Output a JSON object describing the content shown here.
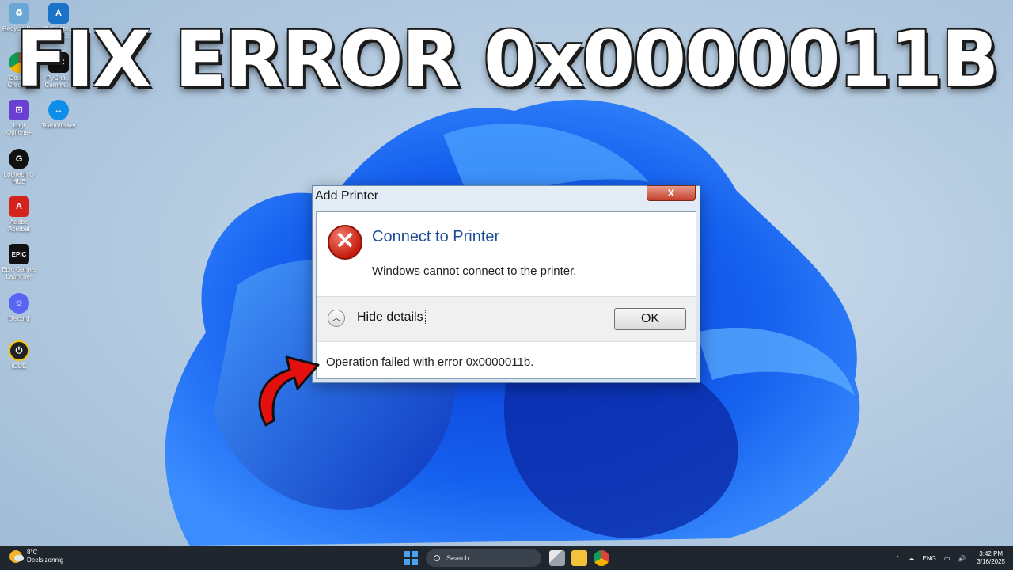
{
  "headline": "FIX ERROR 0x0000011B",
  "desktop_icons": [
    {
      "label": "Recycle Bin",
      "icon": "recycle-bin-icon",
      "color": "#6aa6d6"
    },
    {
      "label": "AVG Inte... Secur...",
      "icon": "avg-icon",
      "color": "#1a73c9"
    },
    {
      "label": "Google Chrome",
      "icon": "chrome-icon",
      "color": "#db4437"
    },
    {
      "label": "PyCha... Commu...",
      "icon": "pycharm-icon",
      "color": "#111111"
    },
    {
      "label": "Logi Options+",
      "icon": "logi-options-icon",
      "color": "#6b3fd1"
    },
    {
      "label": "TeamViewer",
      "icon": "teamviewer-icon",
      "color": "#0e8ee9"
    },
    {
      "label": "Logitech G HUB",
      "icon": "logitech-ghub-icon",
      "color": "#111111"
    },
    {
      "label": "Adobe Acrobat",
      "icon": "acrobat-icon",
      "color": "#d4231c"
    },
    {
      "label": "Epic Games Launcher",
      "icon": "epic-games-icon",
      "color": "#111111"
    },
    {
      "label": "Discord",
      "icon": "discord-icon",
      "color": "#5865f2"
    },
    {
      "label": "iCUE",
      "icon": "icue-icon",
      "color": "#222222"
    }
  ],
  "dialog": {
    "title": "Add Printer",
    "close_glyph": "x",
    "heading": "Connect to Printer",
    "message": "Windows cannot connect to the printer.",
    "hide_details": "Hide details",
    "ok_label": "OK",
    "detail": "Operation failed with error 0x0000011b."
  },
  "taskbar": {
    "weather_temp": "8°C",
    "weather_desc": "Deels zonnig",
    "search_placeholder": "Search",
    "language": "ENG",
    "time": "3:42 PM",
    "date": "3/16/2025"
  },
  "colors": {
    "accent_blue": "#1d4c96",
    "error_red": "#c51d0f",
    "arrow_red": "#e3100f"
  }
}
